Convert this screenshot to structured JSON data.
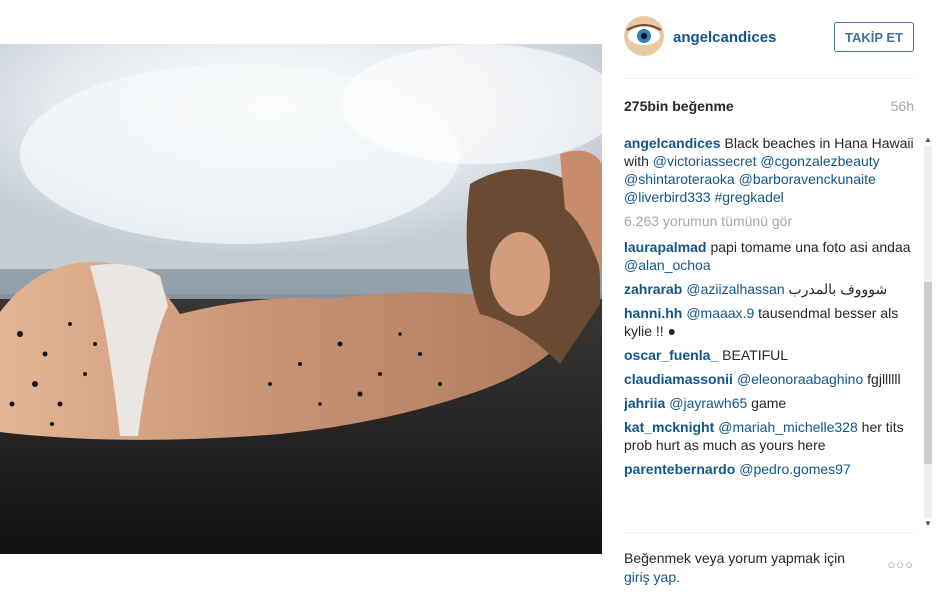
{
  "post": {
    "image_alt": "photo"
  },
  "header": {
    "username": "angelcandices",
    "follow_label": "TAKİP ET"
  },
  "stats": {
    "likes": "275bin beğenme",
    "time_ago": "56h"
  },
  "caption": {
    "user": "angelcandices",
    "text": "Black beaches in Hana Hawaii with",
    "mentions": [
      "@victoriassecret",
      "@cgonzalezbeauty",
      "@shintaroteraoka",
      "@barboravenckunaite",
      "@liverbird333",
      "#gregkadel"
    ]
  },
  "view_all_comments": "6.263 yorumun tümünü gör",
  "comments": [
    {
      "user": "laurapalmad",
      "pre": "papi tomame una foto asi andaa",
      "mention": "@alan_ochoa",
      "post": ""
    },
    {
      "user": "zahrarab",
      "pre": "",
      "mention": "@aziizalhassan",
      "post": "شوووف بالمدرب"
    },
    {
      "user": "hanni.hh",
      "pre": "",
      "mention": "@maaax.9",
      "post": "tausendmal besser als kylie !!"
    },
    {
      "user": "oscar_fuenla_",
      "pre": "BEATIFUL",
      "mention": "",
      "post": ""
    },
    {
      "user": "claudiamassonii",
      "pre": "",
      "mention": "@eleonoraabaghino",
      "post": "fgjllllll"
    },
    {
      "user": "jahriia",
      "pre": "",
      "mention": "@jayrawh65",
      "post": "game"
    },
    {
      "user": "kat_mcknight",
      "pre": "",
      "mention": "@mariah_michelle328",
      "post": "her tits prob hurt as much as yours here"
    },
    {
      "user": "parentebernardo",
      "pre": "",
      "mention": "@pedro.gomes97",
      "post": ""
    }
  ],
  "footer": {
    "prompt": "Beğenmek veya yorum yapmak için",
    "login_link": "giriş yap",
    "suffix": "."
  },
  "colors": {
    "link": "#125688",
    "follow_border": "#3f729b",
    "muted": "#a5a7aa"
  }
}
